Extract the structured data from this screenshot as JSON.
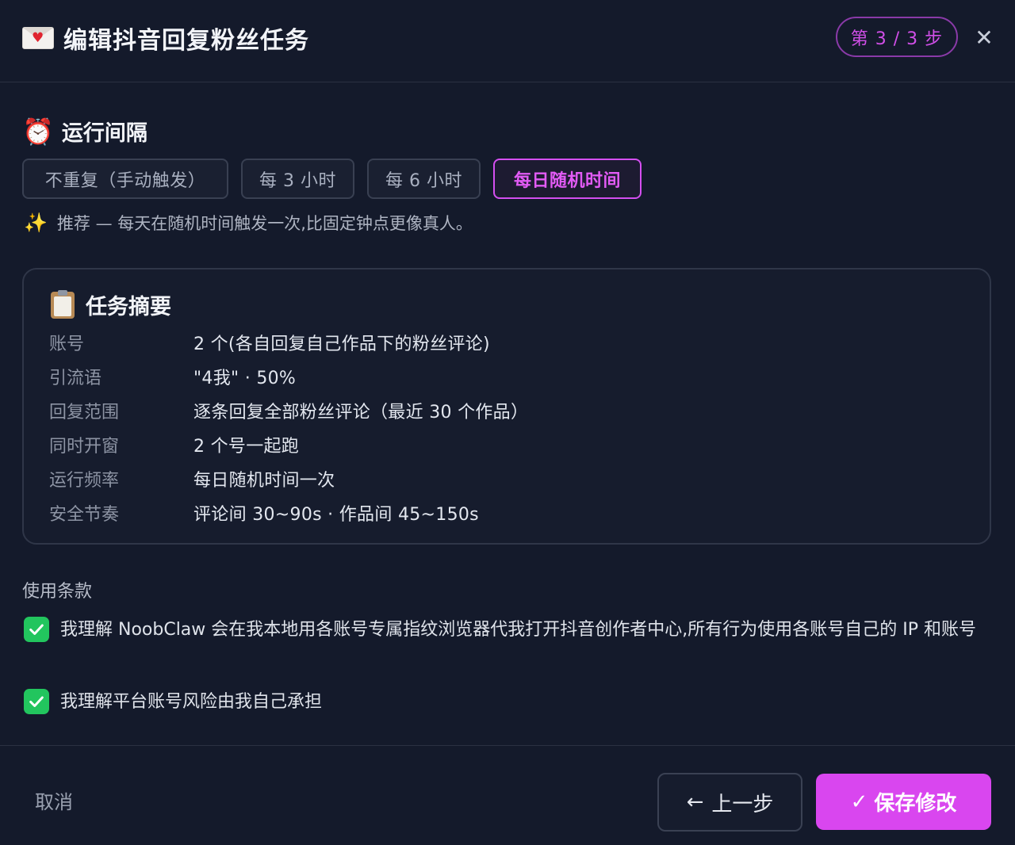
{
  "header": {
    "title": "编辑抖音回复粉丝任务",
    "step": "第 3 / 3 步",
    "close": "✕"
  },
  "interval": {
    "title": "运行间隔",
    "options": [
      {
        "label": "不重复（手动触发）",
        "selected": false
      },
      {
        "label": "每 3 小时",
        "selected": false
      },
      {
        "label": "每 6 小时",
        "selected": false
      },
      {
        "label": "每日随机时间",
        "selected": true
      }
    ],
    "hint": "推荐 — 每天在随机时间触发一次,比固定钟点更像真人。"
  },
  "summary": {
    "title": "任务摘要",
    "rows": [
      {
        "key": "账号",
        "value": "2 个(各自回复自己作品下的粉丝评论)"
      },
      {
        "key": "引流语",
        "value": "\"4我\" · 50%"
      },
      {
        "key": "回复范围",
        "value": "逐条回复全部粉丝评论（最近 30 个作品）"
      },
      {
        "key": "同时开窗",
        "value": "2 个号一起跑"
      },
      {
        "key": "运行频率",
        "value": "每日随机时间一次"
      },
      {
        "key": "安全节奏",
        "value": "评论间 30~90s · 作品间 45~150s"
      }
    ]
  },
  "terms": {
    "title": "使用条款",
    "items": [
      {
        "text": "我理解 NoobClaw 会在我本地用各账号专属指纹浏览器代我打开抖音创作者中心,所有行为使用各账号自己的 IP 和账号",
        "checked": true
      },
      {
        "text": "我理解平台账号风险由我自己承担",
        "checked": true
      }
    ]
  },
  "footer": {
    "cancel": "取消",
    "prev": "上一步",
    "save": "保存修改"
  },
  "colors": {
    "background": "#141a2b",
    "accent": "#d946ef",
    "checkbox": "#22c55e"
  },
  "icons": [
    "envelope-heart-icon",
    "alarm-clock-icon",
    "sparkles-icon",
    "clipboard-icon",
    "checkbox-check-icon",
    "arrow-left-icon",
    "check-icon",
    "close-icon"
  ]
}
